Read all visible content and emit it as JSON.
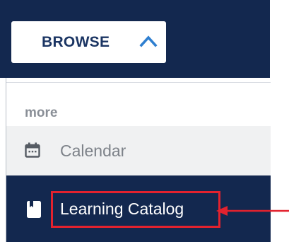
{
  "browse": {
    "label": "BROWSE",
    "icon": "chevron-up-icon",
    "state": "expanded"
  },
  "menu": {
    "section_label": "more",
    "items": [
      {
        "label": "Calendar",
        "icon": "calendar-icon"
      },
      {
        "label": "Learning Catalog",
        "icon": "book-icon",
        "selected": true
      }
    ]
  },
  "annotation": {
    "highlight_target": "Learning Catalog",
    "color": "#e3222e"
  },
  "colors": {
    "navy": "#13284f",
    "hover_gray": "#f0f1f2",
    "muted_text": "#8a8f97",
    "button_text": "#1b3563"
  }
}
